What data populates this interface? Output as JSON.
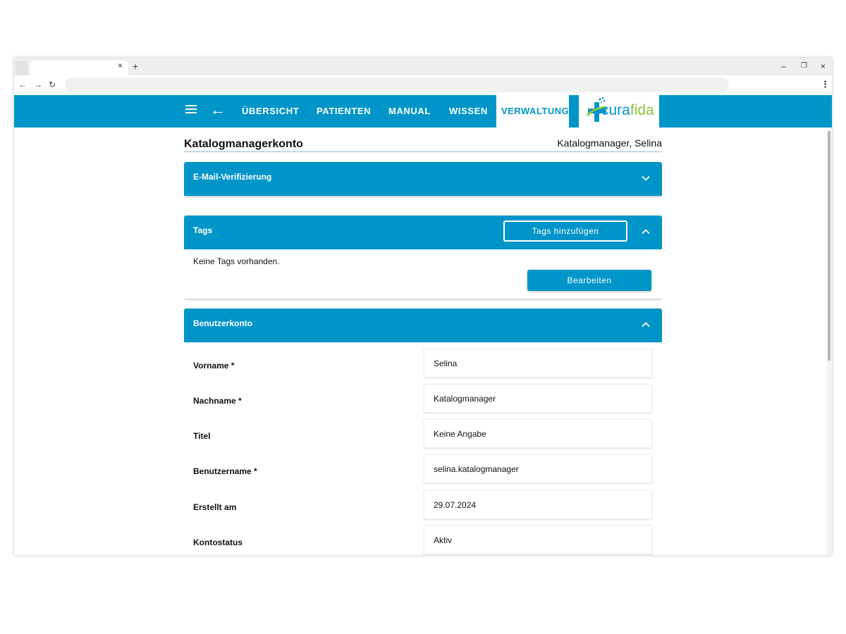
{
  "browser": {
    "tab_close_glyph": "×",
    "new_tab_glyph": "+",
    "window_controls": {
      "minimize": "–",
      "restore": "❐",
      "close": "×"
    },
    "nav_icons": {
      "back": "←",
      "forward": "→",
      "reload": "↻"
    },
    "menu_glyph": "⋮"
  },
  "appbar": {
    "menu_icon": "hamburger-icon",
    "back_glyph": "←",
    "nav_items": [
      "ÜBERSICHT",
      "PATIENTEN",
      "MANUAL",
      "WISSEN"
    ],
    "active_nav": "VERWALTUNG",
    "logo": {
      "part1": "cura",
      "part2": "fida"
    },
    "background_color": "#0095c8"
  },
  "page": {
    "title": "Katalogmanagerkonto",
    "user_display": "Katalogmanager, Selina"
  },
  "sections": {
    "email": {
      "title": "E-Mail-Verifizierung",
      "expanded": false
    },
    "tags": {
      "title": "Tags",
      "add_button": "Tags hinzufügen",
      "empty_text": "Keine Tags vorhanden.",
      "edit_button": "Bearbeiten",
      "expanded": true
    },
    "account": {
      "title": "Benutzerkonto",
      "expanded": true,
      "fields": [
        {
          "label": "Vorname *",
          "value": "Selina"
        },
        {
          "label": "Nachname *",
          "value": "Katalogmanager"
        },
        {
          "label": "Titel",
          "value": "Keine Angabe"
        },
        {
          "label": "Benutzername *",
          "value": "selina.katalogmanager"
        },
        {
          "label": "Erstellt am",
          "value": "29.07.2024"
        },
        {
          "label": "Kontostatus",
          "value": "Aktiv"
        }
      ]
    }
  },
  "colors": {
    "primary": "#0095c8",
    "logo_green": "#8cc63f"
  }
}
